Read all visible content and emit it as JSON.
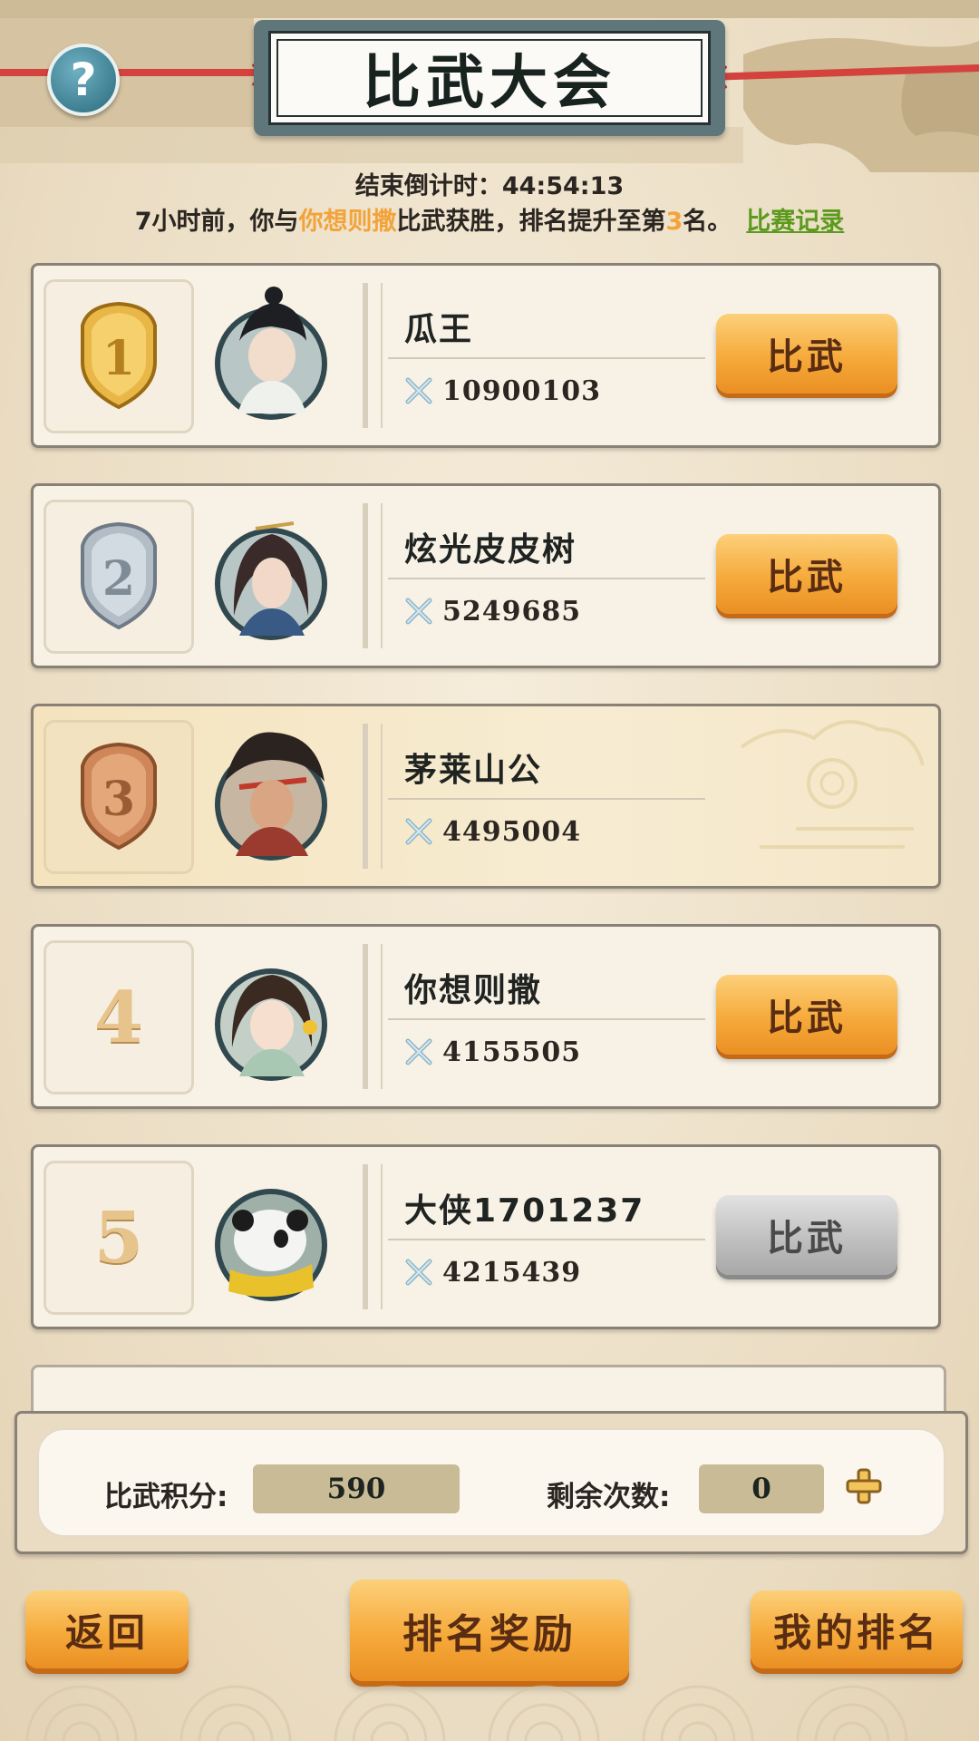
{
  "header": {
    "title": "比武大会",
    "help_icon": "question-mark"
  },
  "info": {
    "countdown_label": "结束倒计时：",
    "countdown_value": "44:54:13",
    "notice_prefix": "7小时前，你与",
    "notice_opponent": "你想则撒",
    "notice_middle": "比武获胜，排名提升至第",
    "notice_rank": "3",
    "notice_suffix": "名。",
    "record_link": "比赛记录"
  },
  "ranking": [
    {
      "rank": "1",
      "badge": "gold-shield",
      "name": "瓜王",
      "power": "10900103",
      "button": "比武",
      "button_state": "active"
    },
    {
      "rank": "2",
      "badge": "silver-shield",
      "name": "炫光皮皮树",
      "power": "5249685",
      "button": "比武",
      "button_state": "active"
    },
    {
      "rank": "3",
      "badge": "bronze-shield",
      "name": "茅莱山公",
      "power": "4495004",
      "button": "",
      "button_state": "self"
    },
    {
      "rank": "4",
      "badge": "number",
      "name": "你想则撒",
      "power": "4155505",
      "button": "比武",
      "button_state": "active"
    },
    {
      "rank": "5",
      "badge": "number",
      "name": "大侠1701237",
      "power": "4215439",
      "button": "比武",
      "button_state": "disabled"
    }
  ],
  "stats": {
    "points_label": "比武积分:",
    "points_value": "590",
    "remaining_label": "剩余次数:",
    "remaining_value": "0"
  },
  "footer": {
    "back": "返回",
    "rank_reward": "排名奖励",
    "my_rank": "我的排名"
  },
  "colors": {
    "accent_orange": "#f6aa3b",
    "highlight_text": "#f2a33a",
    "link_green": "#5c9a1e",
    "gold": "#e2b445",
    "silver": "#b9c2cc",
    "bronze": "#d28d5c"
  }
}
